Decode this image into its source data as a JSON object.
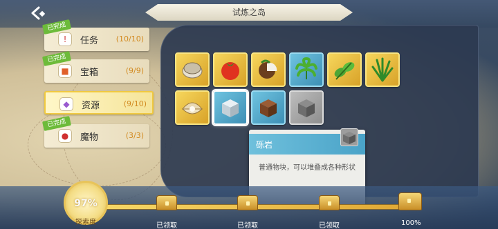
{
  "header": {
    "title": "试炼之岛"
  },
  "tabs": [
    {
      "label": "任务",
      "count": "(10/10)",
      "badge": "已完成",
      "icon": "scroll-icon",
      "active": false
    },
    {
      "label": "宝箱",
      "count": "(9/9)",
      "badge": "已完成",
      "icon": "chest-icon",
      "active": false
    },
    {
      "label": "资源",
      "count": "(9/10)",
      "badge": "",
      "icon": "crystal-icon",
      "active": true
    },
    {
      "label": "魔物",
      "count": "(3/3)",
      "badge": "已完成",
      "icon": "monster-icon",
      "active": false
    }
  ],
  "items": [
    {
      "name": "clam",
      "frame": "gold"
    },
    {
      "name": "tomato",
      "frame": "gold"
    },
    {
      "name": "coconut",
      "frame": "gold"
    },
    {
      "name": "palm-leaf",
      "frame": "blue"
    },
    {
      "name": "mint-leaf",
      "frame": "gold"
    },
    {
      "name": "grass",
      "frame": "gold"
    },
    {
      "name": "oyster-pearl",
      "frame": "gold"
    },
    {
      "name": "marble-block",
      "frame": "blue"
    },
    {
      "name": "dirt-block",
      "frame": "blue"
    },
    {
      "name": "gravel-block",
      "frame": "grey"
    }
  ],
  "tooltip": {
    "name": "砾岩",
    "description": "普通物块，可以堆叠成各种形状"
  },
  "progress": {
    "value": "97%",
    "label": "探索度",
    "fraction": 0.97
  },
  "milestones": [
    {
      "label": "已领取"
    },
    {
      "label": "已领取"
    },
    {
      "label": "已领取"
    },
    {
      "label": "100%"
    }
  ],
  "colors": {
    "gold_frame": "#f6d65c",
    "blue_frame": "#6fc3e0",
    "grey_frame": "#bdbdbd",
    "done_badge": "#6dbb3a",
    "count": "#d28a20"
  }
}
